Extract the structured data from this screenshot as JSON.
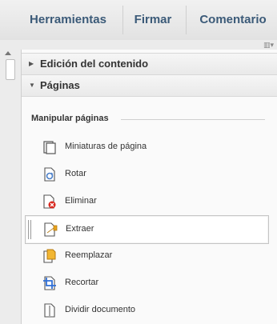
{
  "tabs": [
    "Herramientas",
    "Firmar",
    "Comentario"
  ],
  "sections": [
    {
      "label": "Edición del contenido",
      "expanded": false
    },
    {
      "label": "Páginas",
      "expanded": true
    }
  ],
  "group": {
    "title": "Manipular páginas"
  },
  "items": [
    {
      "label": "Miniaturas de página",
      "icon": "page-thumbnails-icon"
    },
    {
      "label": "Rotar",
      "icon": "rotate-page-icon"
    },
    {
      "label": "Eliminar",
      "icon": "delete-page-icon"
    },
    {
      "label": "Extraer",
      "icon": "extract-page-icon",
      "selected": true
    },
    {
      "label": "Reemplazar",
      "icon": "replace-page-icon"
    },
    {
      "label": "Recortar",
      "icon": "crop-page-icon"
    },
    {
      "label": "Dividir documento",
      "icon": "split-document-icon"
    }
  ],
  "colors": {
    "tab_text": "#3b5a78",
    "delete_badge": "#d9261c",
    "extract_arrow": "#e8a21a",
    "crop_blue": "#2f6fd6"
  }
}
